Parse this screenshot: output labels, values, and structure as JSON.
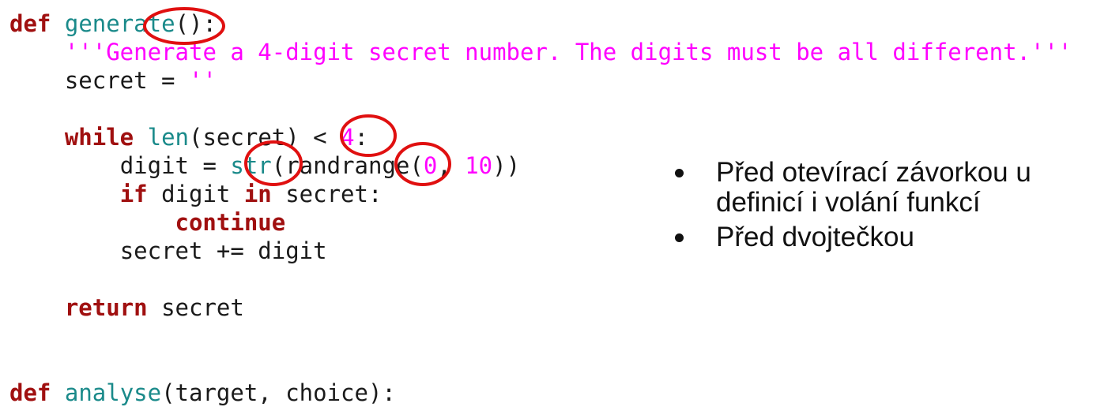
{
  "code": {
    "l1_kw": "def",
    "l1_name": "generate",
    "l1_rest": "():",
    "l2_doc": "'''Generate a 4-digit secret number. The digits must be all different.'''",
    "l3_var": "secret = ",
    "l3_str": "''",
    "l5_kw": "while",
    "l5_fn": "len",
    "l5_mid": "(secret) < ",
    "l5_num": "4",
    "l5_end": ":",
    "l6_a": "digit = ",
    "l6_fn": "str",
    "l6_b": "(randrange(",
    "l6_n1": "0",
    "l6_c": ", ",
    "l6_n2": "10",
    "l6_d": "))",
    "l7_kw1": "if",
    "l7_a": " digit ",
    "l7_kw2": "in",
    "l7_b": " secret:",
    "l8_kw": "continue",
    "l9": "secret += digit",
    "l11_kw": "return",
    "l11_rest": " secret",
    "l14_kw": "def",
    "l14_name": "analyse",
    "l14_rest": "(target, choice):"
  },
  "notes": [
    "Před otevírací závorkou u definicí i volání funkcí",
    "Před dvojtečkou"
  ],
  "colors": {
    "keyword": "#a01010",
    "function": "#1a8a8a",
    "string": "#ff00ff",
    "highlight_circle": "#e01010"
  }
}
